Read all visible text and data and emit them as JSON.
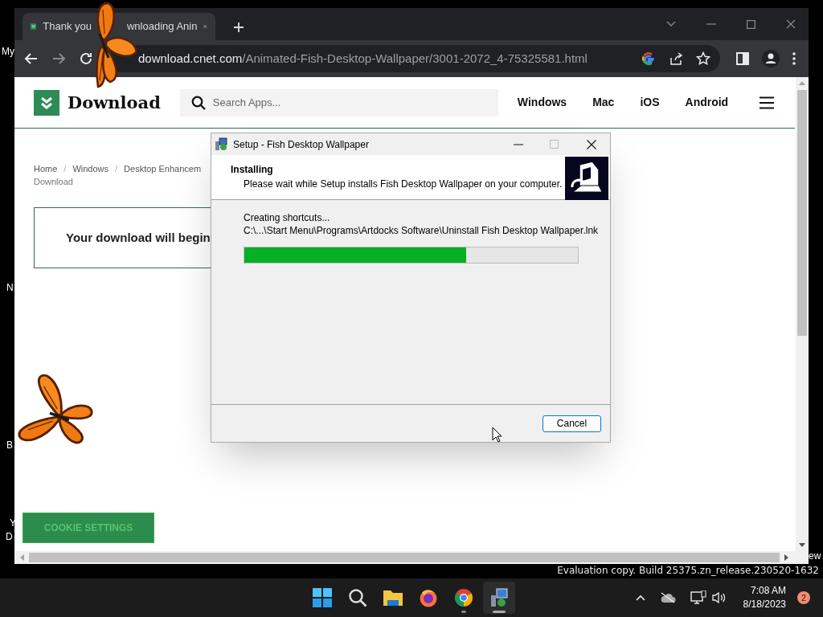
{
  "desktop": {
    "icon_labels": [
      "My",
      "N",
      "B",
      "Y",
      "D",
      "ew"
    ],
    "evaluation_notice": "Evaluation copy. Build 25375.zn_release.230520-1632"
  },
  "browser": {
    "tabs": [
      {
        "title_parts": [
          "Thank you",
          "wnloading Anin"
        ],
        "selected": true
      }
    ],
    "address": {
      "host": "download.cnet.com",
      "path": "/Animated-Fish-Desktop-Wallpaper/3001-2072_4-75325581.html"
    }
  },
  "site": {
    "logo": "Download",
    "search": {
      "placeholder": "Search Apps..."
    },
    "nav": [
      "Windows",
      "Mac",
      "iOS",
      "Android"
    ],
    "breadcrumb": {
      "items": [
        "Home",
        "Windows",
        "Desktop Enhancem"
      ],
      "separator": "/",
      "current": "Download"
    },
    "download_message": "Your download will begin",
    "cookie_button": "COOKIE SETTINGS"
  },
  "dialog": {
    "title": "Setup - Fish Desktop Wallpaper",
    "heading": "Installing",
    "subheading": "Please wait while Setup installs Fish Desktop Wallpaper on your computer.",
    "status": "Creating shortcuts...",
    "file_path": "C:\\...\\Start Menu\\Programs\\Artdocks Software\\Uninstall Fish Desktop Wallpaper.lnk",
    "progress": {
      "level": 0.665
    },
    "buttons": [
      "Cancel"
    ]
  },
  "taskbar": {
    "apps": [
      {
        "kind": "start",
        "running": false,
        "selected": false
      },
      {
        "kind": "search",
        "running": false,
        "selected": false
      },
      {
        "kind": "files",
        "running": false,
        "selected": false
      },
      {
        "kind": "firefox",
        "running": false,
        "selected": false
      },
      {
        "kind": "chrome",
        "running": true,
        "selected": false
      },
      {
        "kind": "setup",
        "running": true,
        "selected": true
      }
    ],
    "time": "7:08 AM",
    "date": "8/18/2023",
    "notification_count": "2"
  }
}
